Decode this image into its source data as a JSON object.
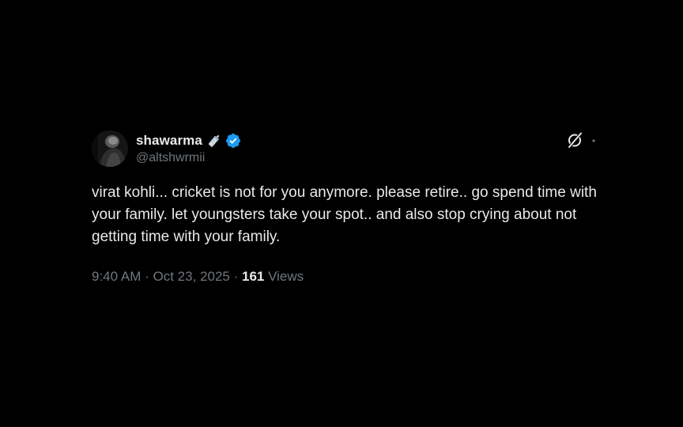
{
  "tweet": {
    "author": {
      "display_name": "shawarma",
      "handle": "@altshwrmii",
      "emoji": "baby-bottle-icon",
      "verified": true,
      "verified_color": "#1d9bf0"
    },
    "text": "virat kohli... cricket is not for you anymore. please retire.. go spend time with your family. let youngsters take your spot.. and also stop crying about not getting time with your family.",
    "time": "9:40 AM",
    "separator": "·",
    "date": "Oct 23, 2025",
    "views_count": "161",
    "views_label": "Views",
    "actions": {
      "grok_icon": "grok-icon",
      "more_icon": "more-dots-icon"
    }
  },
  "colors": {
    "background": "#000000",
    "primary_text": "#e7e9ea",
    "secondary_text": "#71767b",
    "accent": "#1d9bf0"
  }
}
